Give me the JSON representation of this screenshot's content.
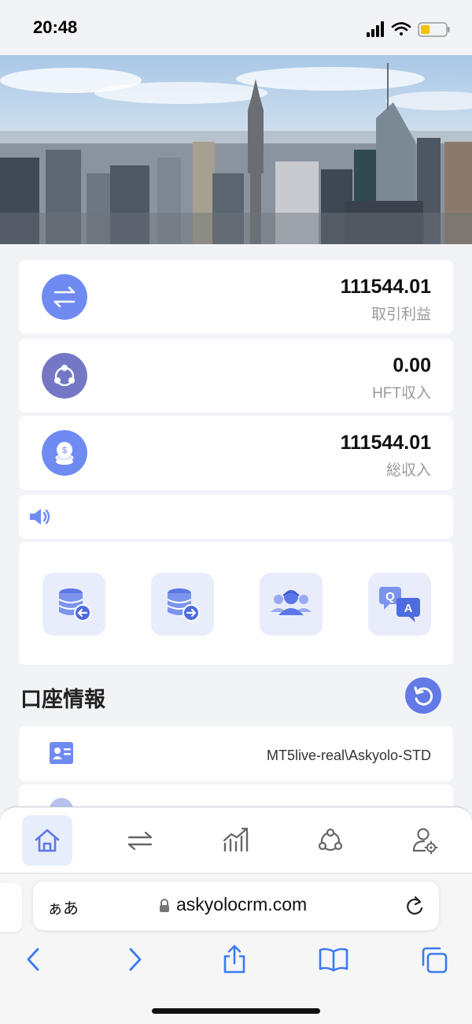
{
  "status": {
    "time": "20:48"
  },
  "stats": [
    {
      "value": "111544.01",
      "label": "取引利益",
      "icon": "swap-arrows-icon"
    },
    {
      "value": "0.00",
      "label": "HFT収入",
      "icon": "network-nodes-icon"
    },
    {
      "value": "111544.01",
      "label": "総収入",
      "icon": "coins-stack-icon"
    }
  ],
  "notice": {
    "icon": "speaker-icon",
    "text": ""
  },
  "shortcuts": [
    {
      "icon": "deposit-database-icon"
    },
    {
      "icon": "withdraw-database-icon"
    },
    {
      "icon": "team-users-icon"
    },
    {
      "icon": "qa-chat-icon"
    }
  ],
  "account": {
    "title": "口座情報",
    "rows": [
      {
        "icon": "id-card-icon",
        "value": "MT5live-real\\Askyolo-STD"
      }
    ]
  },
  "tabbar": {
    "active": 0,
    "items": [
      {
        "icon": "home-icon"
      },
      {
        "icon": "transfer-icon"
      },
      {
        "icon": "chart-trend-icon"
      },
      {
        "icon": "network-icon"
      },
      {
        "icon": "user-settings-icon"
      }
    ]
  },
  "browser": {
    "aa_label": "ぁあ",
    "url": "askyolocrm.com"
  },
  "colors": {
    "accent": "#6279e6",
    "icon_bg": "#e9edfb",
    "page_bg": "#f2f3f7"
  }
}
